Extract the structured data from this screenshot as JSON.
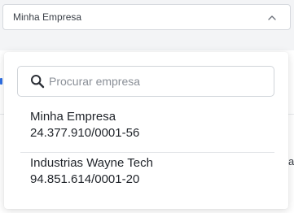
{
  "select": {
    "value": "Minha Empresa",
    "icon": "chevron-up-icon"
  },
  "dropdown": {
    "search": {
      "placeholder": "Procurar empresa",
      "icon": "search-icon"
    },
    "options": [
      {
        "name": "Minha Empresa",
        "cnpj": "24.377.910/0001-56"
      },
      {
        "name": "Industrias Wayne Tech",
        "cnpj": "94.851.614/0001-20"
      }
    ]
  },
  "background": {
    "partial_text": "a"
  },
  "colors": {
    "accent": "#2f6fe4",
    "border": "#d6d9de",
    "text": "#1f2329",
    "placeholder": "#8a8f97"
  }
}
